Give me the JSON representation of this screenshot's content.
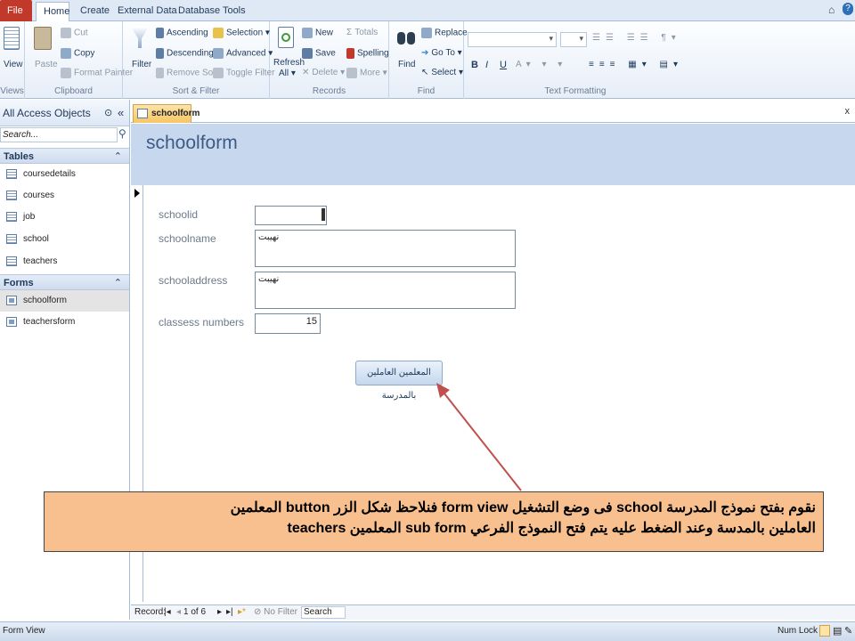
{
  "tabs": [
    "File",
    "Home",
    "Create",
    "External Data",
    "Database Tools"
  ],
  "ribbon": {
    "views": {
      "view": "View",
      "label": "Views"
    },
    "clipboard": {
      "paste": "Paste",
      "cut": "Cut",
      "copy": "Copy",
      "format_painter": "Format Painter",
      "label": "Clipboard"
    },
    "sort_filter": {
      "filter": "Filter",
      "ascending": "Ascending",
      "descending": "Descending",
      "remove_sort": "Remove Sort",
      "selection": "Selection",
      "advanced": "Advanced",
      "toggle_filter": "Toggle Filter",
      "label": "Sort & Filter"
    },
    "records": {
      "refresh": "Refresh",
      "refresh_all": "All",
      "new": "New",
      "save": "Save",
      "delete": "Delete",
      "totals": "Totals",
      "spelling": "Spelling",
      "more": "More",
      "label": "Records"
    },
    "find": {
      "find": "Find",
      "replace": "Replace",
      "goto": "Go To",
      "select": "Select",
      "label": "Find"
    },
    "text_formatting": {
      "bold": "B",
      "italic": "I",
      "underline": "U",
      "label": "Text Formatting"
    }
  },
  "nav": {
    "title": "All Access Objects",
    "search_placeholder": "Search...",
    "tables_header": "Tables",
    "tables": [
      "coursedetails",
      "courses",
      "job",
      "school",
      "teachers"
    ],
    "forms_header": "Forms",
    "forms": [
      "schoolform",
      "teachersform"
    ]
  },
  "document": {
    "tab_label": "schoolform",
    "close": "x",
    "form_title": "schoolform",
    "fields": {
      "schoolid_label": "schoolid",
      "schoolid_value": "",
      "schoolname_label": "schoolname",
      "schoolname_value": "نهيبت",
      "schooladdress_label": "schooladdress",
      "schooladdress_value": "نهيبت",
      "classes_label": "classess numbers",
      "classes_value": "15"
    },
    "subform_button": "المعلمين العاملين بالمدرسة"
  },
  "callout": {
    "line1": "نقوم بفتح نموذج المدرسة school فى وضع التشغيل form view فنلاحظ شكل الزر button المعلمين",
    "line2": "العاملين بالمدسة وعند الضغط عليه يتم فتح النموذج الفرعي sub form المعلمين teachers"
  },
  "record_nav": {
    "record_label": "Record:",
    "position": "1 of 6",
    "no_filter": "No Filter",
    "search": "Search"
  },
  "status": {
    "left": "Form View",
    "num_lock": "Num Lock"
  }
}
